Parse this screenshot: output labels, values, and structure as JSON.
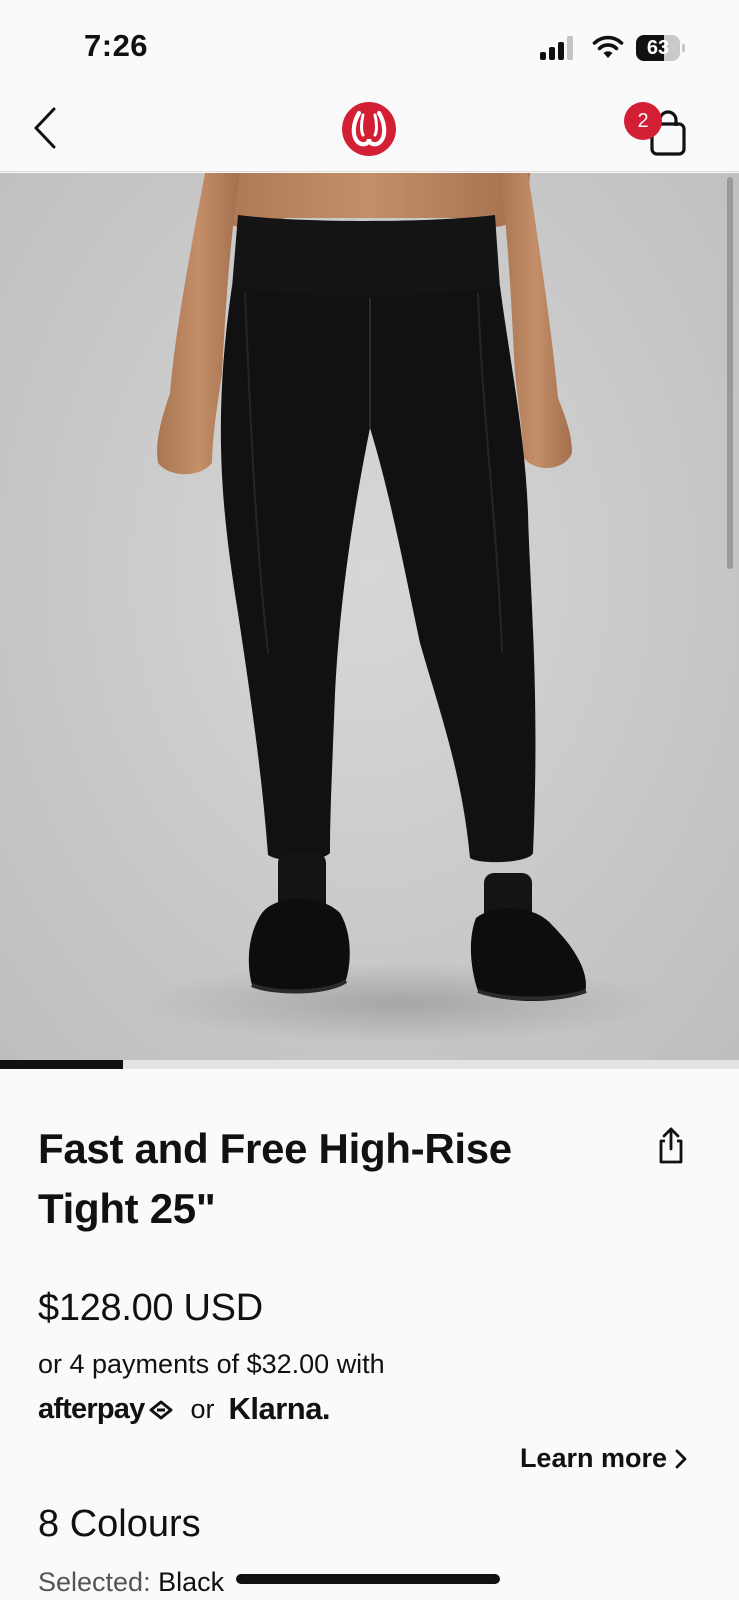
{
  "status_bar": {
    "time": "7:26",
    "battery_level": 63,
    "signal_bars": 3,
    "icons": [
      "signal-icon",
      "wifi-icon",
      "battery-icon"
    ]
  },
  "nav": {
    "back_icon": "chevron-left-icon",
    "logo": "lululemon-logo",
    "bag_icon": "shopping-bag-icon",
    "bag_count": "2",
    "badge_color": "#d31f33"
  },
  "gallery": {
    "image": "product-photo-black-leggings",
    "progress": 0.167
  },
  "product": {
    "title": "Fast and Free High-Rise Tight 25\"",
    "share_icon": "share-icon",
    "price": "$128.00 USD",
    "installments": "or 4 payments of $32.00 with",
    "afterpay": "afterpay",
    "or": "or",
    "klarna": "Klarna.",
    "learn_more": "Learn more",
    "colours": "8 Colours",
    "selected_label": "Selected:",
    "selected_value": "Black"
  },
  "colors": {
    "brand_red": "#d31f33",
    "text": "#111111",
    "background": "#fafafa"
  }
}
